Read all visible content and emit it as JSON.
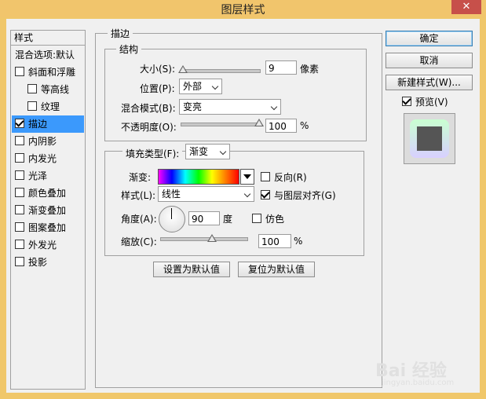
{
  "window": {
    "title": "图层样式",
    "close_label": "✕"
  },
  "left_panel": {
    "header": "样式",
    "items": [
      {
        "label": "混合选项:默认",
        "checkbox": false,
        "checked": false,
        "indent": false,
        "selected": false
      },
      {
        "label": "斜面和浮雕",
        "checkbox": true,
        "checked": false,
        "indent": false,
        "selected": false
      },
      {
        "label": "等高线",
        "checkbox": true,
        "checked": false,
        "indent": true,
        "selected": false
      },
      {
        "label": "纹理",
        "checkbox": true,
        "checked": false,
        "indent": true,
        "selected": false
      },
      {
        "label": "描边",
        "checkbox": true,
        "checked": true,
        "indent": false,
        "selected": true
      },
      {
        "label": "内阴影",
        "checkbox": true,
        "checked": false,
        "indent": false,
        "selected": false
      },
      {
        "label": "内发光",
        "checkbox": true,
        "checked": false,
        "indent": false,
        "selected": false
      },
      {
        "label": "光泽",
        "checkbox": true,
        "checked": false,
        "indent": false,
        "selected": false
      },
      {
        "label": "颜色叠加",
        "checkbox": true,
        "checked": false,
        "indent": false,
        "selected": false
      },
      {
        "label": "渐变叠加",
        "checkbox": true,
        "checked": false,
        "indent": false,
        "selected": false
      },
      {
        "label": "图案叠加",
        "checkbox": true,
        "checked": false,
        "indent": false,
        "selected": false
      },
      {
        "label": "外发光",
        "checkbox": true,
        "checked": false,
        "indent": false,
        "selected": false
      },
      {
        "label": "投影",
        "checkbox": true,
        "checked": false,
        "indent": false,
        "selected": false
      }
    ]
  },
  "stroke": {
    "group_title": "描边",
    "structure_title": "结构",
    "size_label": "大小(S):",
    "size_value": "9",
    "size_unit": "像素",
    "size_fraction": 0.03,
    "position_label": "位置(P):",
    "position_value": "外部",
    "blend_label": "混合模式(B):",
    "blend_value": "变亮",
    "opacity_label": "不透明度(O):",
    "opacity_value": "100",
    "opacity_unit": "%",
    "opacity_fraction": 1.0,
    "fill_type_label": "填充类型(F):",
    "fill_type_value": "渐变",
    "gradient_label": "渐变:",
    "reverse_label": "反向(R)",
    "reverse_checked": false,
    "style_label": "样式(L):",
    "style_value": "线性",
    "align_label": "与图层对齐(G)",
    "align_checked": true,
    "angle_label": "角度(A):",
    "angle_value": "90",
    "angle_unit": "度",
    "dither_label": "仿色",
    "dither_checked": false,
    "scale_label": "缩放(C):",
    "scale_value": "100",
    "scale_unit": "%",
    "scale_fraction": 0.6,
    "set_default_label": "设置为默认值",
    "reset_default_label": "复位为默认值"
  },
  "right_panel": {
    "ok_label": "确定",
    "cancel_label": "取消",
    "new_style_label": "新建样式(W)...",
    "preview_label": "预览(V)",
    "preview_checked": true
  },
  "watermark": {
    "text": "Bai 经验",
    "sub": "jingyan.baidu.com"
  }
}
